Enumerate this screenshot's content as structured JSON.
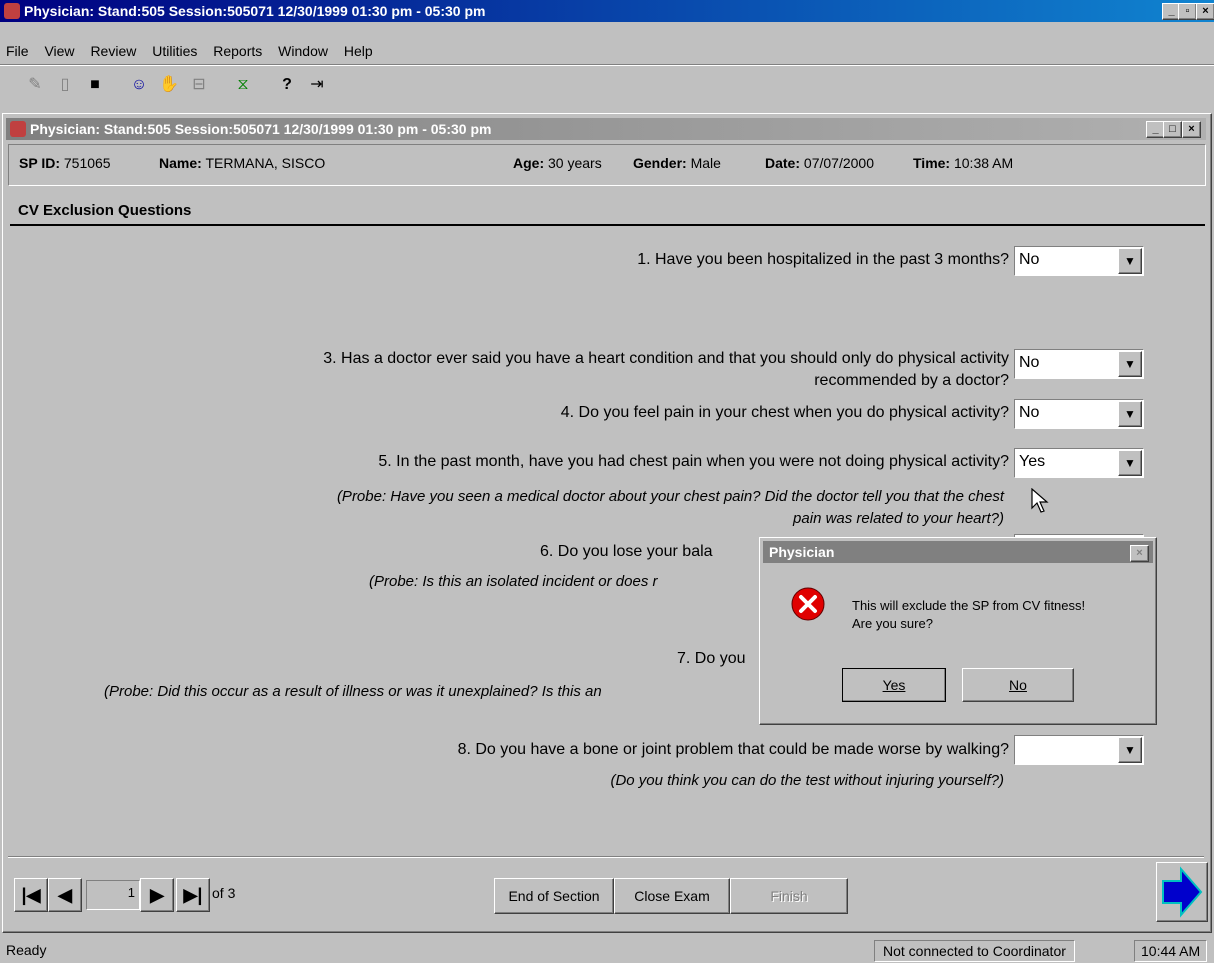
{
  "app": {
    "title": "Physician: Stand:505 Session:505071 12/30/1999 01:30 pm - 05:30 pm",
    "menu": [
      "File",
      "View",
      "Review",
      "Utilities",
      "Reports",
      "Window",
      "Help"
    ]
  },
  "child": {
    "title": "Physician: Stand:505 Session:505071 12/30/1999 01:30 pm - 05:30 pm"
  },
  "header": {
    "spid_label": "SP ID:",
    "spid": "751065",
    "name_label": "Name:",
    "name": "TERMANA, SISCO",
    "age_label": "Age:",
    "age": "30 years",
    "gender_label": "Gender:",
    "gender": "Male",
    "date_label": "Date:",
    "date": "07/07/2000",
    "time_label": "Time:",
    "time": "10:38 AM"
  },
  "section": {
    "title": "CV Exclusion Questions"
  },
  "questions": {
    "q1": {
      "text": "1. Have you been hospitalized in the past 3 months?",
      "answer": "No"
    },
    "q3": {
      "text_line1": "3. Has a doctor ever said you have a heart condition and that you should only do physical activity",
      "text_line2": "recommended by a doctor?",
      "answer": "No"
    },
    "q4": {
      "text": "4. Do you feel pain in your chest when you do physical activity?",
      "answer": "No"
    },
    "q5": {
      "text": "5. In the past month, have you had chest pain when you were not doing physical activity?",
      "answer": "Yes",
      "probe_line1": "(Probe: Have you seen a medical doctor about your chest pain? Did the doctor tell you that the chest",
      "probe_line2": "pain was related to your heart?)"
    },
    "q6": {
      "text": "6. Do you lose your bala",
      "probe": "(Probe: Is this an isolated incident or does r"
    },
    "q7": {
      "text": "7. Do you",
      "probe": "(Probe: Did this occur as a result of illness or was it unexplained? Is this an"
    },
    "q8": {
      "text": "8. Do you have a bone or joint problem that could be made worse by walking?",
      "answer": "",
      "probe": "(Do you think you can do the test without injuring yourself?)"
    }
  },
  "nav": {
    "page": "1",
    "of": "of 3",
    "end_section": "End of Section",
    "close_exam": "Close Exam",
    "finish": "Finish"
  },
  "dialog": {
    "title": "Physician",
    "close": "×",
    "message_line1": "This will exclude the SP from CV fitness!",
    "message_line2": "Are you sure?",
    "yes": "Yes",
    "no": "No"
  },
  "status": {
    "left": "Ready",
    "coordinator": "Not connected to Coordinator",
    "time": "10:44 AM"
  },
  "colors": {
    "active_title": "#000080",
    "inactive_title": "#808080",
    "error_icon": "#e00000",
    "next_arrow": "#0000cc"
  }
}
